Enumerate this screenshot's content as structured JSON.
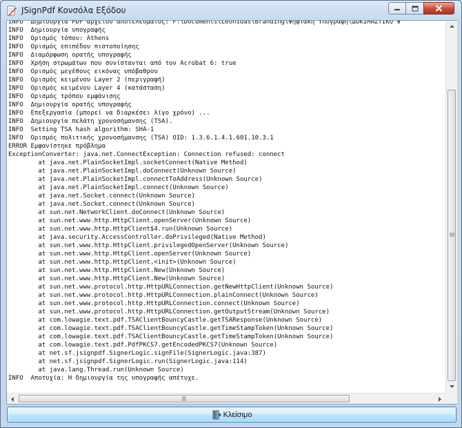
{
  "window": {
    "title": "JSignPdf Κονσόλα Εξόδου"
  },
  "console": {
    "lines": [
      "INFO  Δημιουργία PDF αρχείου αποτελέσματος: F:\\Documents\\Leonidas\\Branding\\Ψηφιακή Υπογραφή\\ΔΟΚΙΜΑΣΤΙΚΟ Ψ",
      "INFO  Δημιουργία υπογραφής",
      "INFO  Ορισμός τόπου: Athens",
      "INFO  Ορισμός επιπέδου πιστοποίησης",
      "INFO  Διαμόρφωση ορατής υπογραφής",
      "INFO  Χρήση στρωμάτων που συνίστανται από τον Acrobat 6: true",
      "INFO  Ορισμός μεγέθους εικόνας υπόβαθρου",
      "INFO  Ορισμός κειμένου Layer 2 (περιγραφή)",
      "INFO  Ορισμός κειμένου Layer 4 (κατάσταση)",
      "INFO  Ορισμός τρόπου εμφάνισης",
      "INFO  Δημιουργία ορατής υπογραφής",
      "INFO  Επεξεργασία (μπορεί να διαρκέσει λίγο χρόνο) ...",
      "INFO  Δημιουργία πελάτη χρονοσήμανσης (TSA).",
      "INFO  Setting TSA hash algorithm: SHA-1",
      "INFO  Ορισμός πολιτικής χρονοσήμανσης (TSA) OID: 1.3.6.1.4.1.601.10.3.1",
      "ERROR Εμφανίστηκε πρόβλημα",
      "ExceptionConverter: java.net.ConnectException: Connection refused: connect",
      "        at java.net.PlainSocketImpl.socketConnect(Native Method)",
      "        at java.net.PlainSocketImpl.doConnect(Unknown Source)",
      "        at java.net.PlainSocketImpl.connectToAddress(Unknown Source)",
      "        at java.net.PlainSocketImpl.connect(Unknown Source)",
      "        at java.net.Socket.connect(Unknown Source)",
      "        at java.net.Socket.connect(Unknown Source)",
      "        at sun.net.NetworkClient.doConnect(Unknown Source)",
      "        at sun.net.www.http.HttpClient.openServer(Unknown Source)",
      "        at sun.net.www.http.HttpClient$4.run(Unknown Source)",
      "        at java.security.AccessController.doPrivileged(Native Method)",
      "        at sun.net.www.http.HttpClient.privilegedOpenServer(Unknown Source)",
      "        at sun.net.www.http.HttpClient.openServer(Unknown Source)",
      "        at sun.net.www.http.HttpClient.<init>(Unknown Source)",
      "        at sun.net.www.http.HttpClient.New(Unknown Source)",
      "        at sun.net.www.http.HttpClient.New(Unknown Source)",
      "        at sun.net.www.protocol.http.HttpURLConnection.getNewHttpClient(Unknown Source)",
      "        at sun.net.www.protocol.http.HttpURLConnection.plainConnect(Unknown Source)",
      "        at sun.net.www.protocol.http.HttpURLConnection.connect(Unknown Source)",
      "        at sun.net.www.protocol.http.HttpURLConnection.getOutputStream(Unknown Source)",
      "        at com.lowagie.text.pdf.TSAClientBouncyCastle.getTSAResponse(Unknown Source)",
      "        at com.lowagie.text.pdf.TSAClientBouncyCastle.getTimeStampToken(Unknown Source)",
      "        at com.lowagie.text.pdf.TSAClientBouncyCastle.getTimeStampToken(Unknown Source)",
      "        at com.lowagie.text.pdf.PdfPKCS7.getEncodedPKCS7(Unknown Source)",
      "        at net.sf.jsignpdf.SignerLogic.signFile(SignerLogic.java:387)",
      "        at net.sf.jsignpdf.SignerLogic.run(SignerLogic.java:114)",
      "        at java.lang.Thread.run(Unknown Source)",
      "INFO  Αποτυχία: Η δημιουργία της υπογραφής απέτυχε."
    ]
  },
  "footer": {
    "close_label": "Κλείσιμο"
  },
  "icons": {
    "app": "jsignpdf-icon",
    "button": "close-door-icon"
  },
  "colors": {
    "close_control": "#c94a36",
    "button_border": "#3c7fb1"
  }
}
